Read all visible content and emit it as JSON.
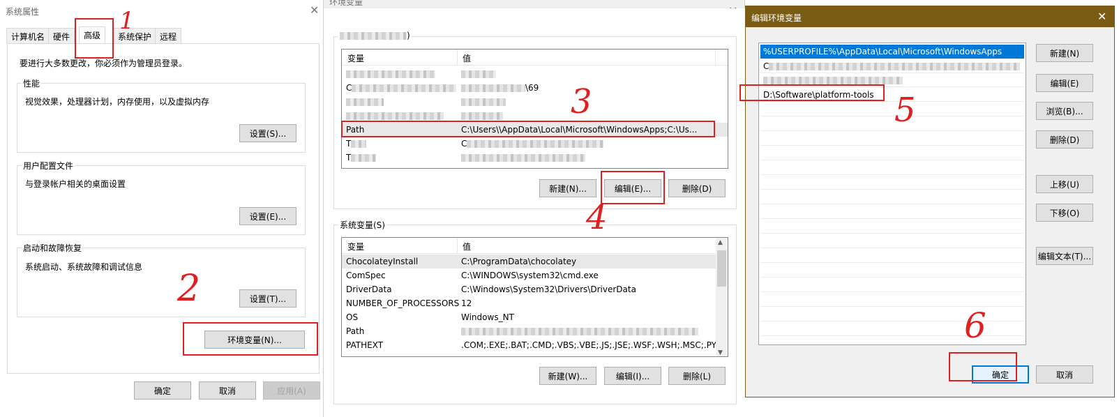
{
  "sys_props": {
    "title": "系统属性",
    "tabs": [
      "计算机名",
      "硬件",
      "高级",
      "系统保护",
      "远程"
    ],
    "admin_note": "要进行大多数更改，你必须作为管理员登录。",
    "performance": {
      "title": "性能",
      "desc": "视觉效果，处理器计划，内存使用，以及虚拟内存",
      "button": "设置(S)..."
    },
    "profile": {
      "title": "用户配置文件",
      "desc": "与登录帐户相关的桌面设置",
      "button": "设置(E)..."
    },
    "startup": {
      "title": "启动和故障恢复",
      "desc": "系统启动、系统故障和调试信息",
      "button": "设置(T)..."
    },
    "env_button": "环境变量(N)...",
    "ok": "确定",
    "cancel": "取消",
    "apply": "应用(A)"
  },
  "env_vars": {
    "title": "环境变量",
    "user_section_suffix": ")",
    "col_var": "变量",
    "col_val": "值",
    "user_rows": [
      {
        "name": "",
        "value": ""
      },
      {
        "name": "C",
        "value": "\\69"
      },
      {
        "name": "",
        "value": ""
      },
      {
        "name": "",
        "value": ""
      },
      {
        "name": "Path",
        "value": "C:\\Users\\\\AppData\\Local\\Microsoft\\WindowsApps;C:\\Us..."
      },
      {
        "name": "T",
        "value": "C"
      },
      {
        "name": "T",
        "value": ""
      }
    ],
    "user_buttons": {
      "new": "新建(N)...",
      "edit": "编辑(E)...",
      "delete": "删除(D)"
    },
    "system_title": "系统变量(S)",
    "system_rows": [
      {
        "name": "ChocolateyInstall",
        "value": "C:\\ProgramData\\chocolatey"
      },
      {
        "name": "ComSpec",
        "value": "C:\\WINDOWS\\system32\\cmd.exe"
      },
      {
        "name": "DriverData",
        "value": "C:\\Windows\\System32\\Drivers\\DriverData"
      },
      {
        "name": "NUMBER_OF_PROCESSORS",
        "value": "12"
      },
      {
        "name": "OS",
        "value": "Windows_NT"
      },
      {
        "name": "Path",
        "value": ""
      },
      {
        "name": "PATHEXT",
        "value": ".COM;.EXE;.BAT;.CMD;.VBS;.VBE;.JS;.JSE;.WSF;.WSH;.MSC;.PY;.P..."
      }
    ],
    "system_buttons": {
      "new": "新建(W)...",
      "edit": "编辑(I)...",
      "delete": "删除(L)"
    }
  },
  "edit_env": {
    "title": "编辑环境变量",
    "entries": [
      "%USERPROFILE%\\AppData\\Local\\Microsoft\\WindowsApps",
      "C",
      "",
      "D:\\Software\\platform-tools"
    ],
    "buttons": {
      "new": "新建(N)",
      "edit": "编辑(E)",
      "browse": "浏览(B)...",
      "delete": "删除(D)",
      "up": "上移(U)",
      "down": "下移(O)",
      "edit_text": "编辑文本(T)..."
    },
    "ok": "确定",
    "cancel": "取消"
  },
  "annotations": {
    "step_numbers": [
      "1",
      "2",
      "3",
      "4",
      "5",
      "6"
    ],
    "color": "#e02020"
  },
  "colors": {
    "selection": "#0078d7",
    "title_bar_active": "#7a5c14",
    "annotation": "#e02020"
  }
}
